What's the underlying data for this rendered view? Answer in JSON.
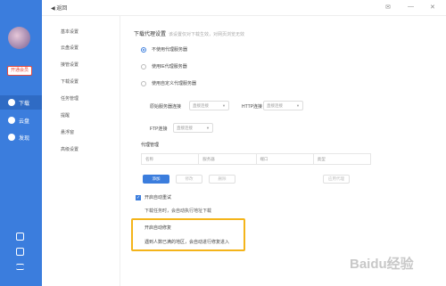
{
  "header": {
    "back_label": "返回"
  },
  "sidebar": {
    "vip_label": "开通会员",
    "nav": [
      {
        "label": "下载",
        "icon": "download-icon"
      },
      {
        "label": "云盘",
        "icon": "cloud-icon"
      },
      {
        "label": "发现",
        "icon": "compass-icon"
      }
    ]
  },
  "menu": {
    "items": [
      "基本设置",
      "云盘设置",
      "接管设置",
      "下载设置",
      "任务管理",
      "提醒",
      "悬浮窗",
      "高级设置"
    ]
  },
  "proxy": {
    "title": "下载代理设置",
    "hint": "该设置仅对下载生效，对网页浏览无效",
    "options": [
      "不使用代理服务器",
      "使用IE代理服务器",
      "使用自定义代理服务器"
    ],
    "selected_index": 0,
    "source_label": "原始服务器连接",
    "source_value": "直接连接",
    "http_label": "HTTP连接",
    "http_value": "直接连接",
    "ftp_label": "FTP连接",
    "ftp_value": "直接连接",
    "manager_title": "代理管理",
    "columns": [
      "名称",
      "服务器",
      "端口",
      "类型"
    ],
    "add": "添加",
    "edit": "修改",
    "delete": "删除",
    "apply": "应用代理"
  },
  "fallback": {
    "checkbox_label": "开启自动重试",
    "desc": "下载任务时，会自动执行地址下载"
  },
  "auto": {
    "title": "开启自动修复",
    "desc": "遇到人数已满的地区，会自动进行修复进入"
  },
  "watermark": "Baidu经验"
}
